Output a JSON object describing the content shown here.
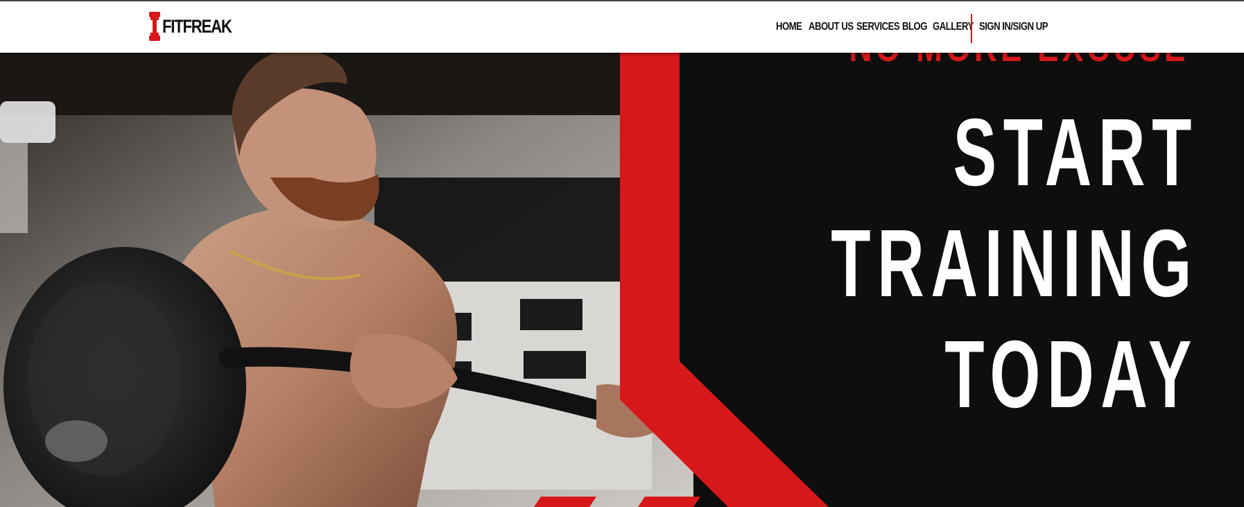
{
  "brand": {
    "name": "FITFREAK",
    "icon": "dumbbell-icon"
  },
  "nav": {
    "home": "HOME",
    "about": "ABOUT US",
    "services": "SERVICES",
    "blog": "BLOG",
    "gallery": "GALLERY",
    "sign_in": "SIGN IN/SIGN UP"
  },
  "hero": {
    "tagline": "NO MORE EXCUSE",
    "headline_line1": "START",
    "headline_line2": "TRAINING",
    "headline_line3": "TODAY"
  },
  "colors": {
    "accent": "#d7181b",
    "dark": "#0e0e0e",
    "nav_bg": "#ffffff",
    "text_dark": "#111111",
    "text_light": "#ffffff"
  }
}
